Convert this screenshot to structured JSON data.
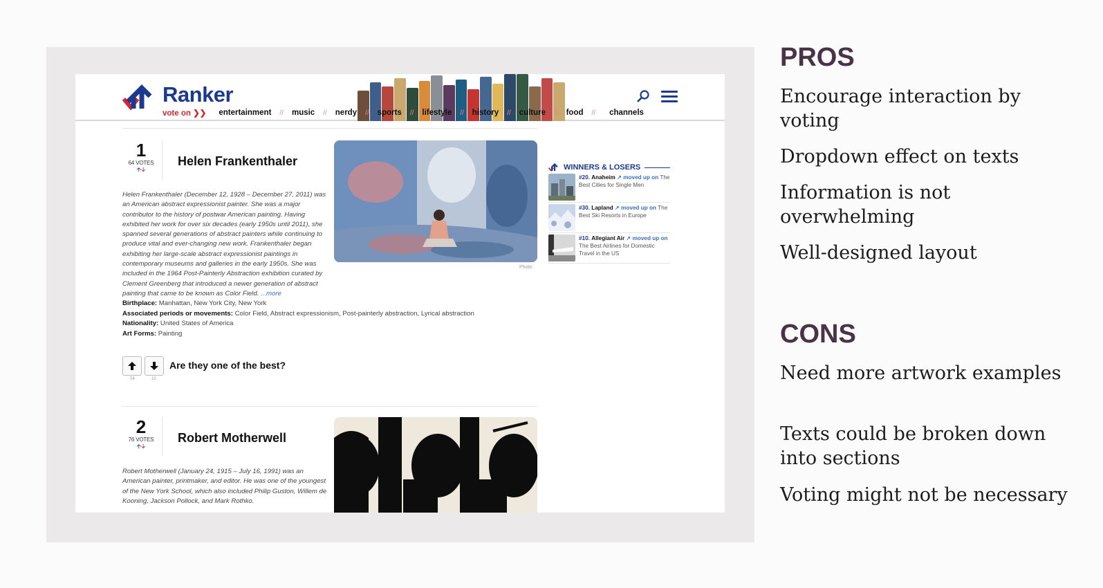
{
  "slide": {
    "pros_heading": "PROS",
    "pros": [
      "Encourage interaction by voting",
      "Dropdown effect on texts",
      "Information is not overwhelming",
      "Well-designed layout"
    ],
    "cons_heading": "CONS",
    "cons": [
      "Need more artwork examples",
      "Texts could be broken down into sections",
      "Voting might not be necessary"
    ]
  },
  "ranker": {
    "logo": "Ranker",
    "vote_on": "vote on",
    "nav": [
      "entertainment",
      "music",
      "nerdy",
      "sports",
      "lifestyle",
      "history",
      "culture",
      "food"
    ],
    "channels": "channels",
    "entries": [
      {
        "rank": "1",
        "votes": "64 VOTES",
        "name": "Helen Frankenthaler",
        "description": "Helen Frankenthaler (December 12, 1928 – December 27, 2011) was an American abstract expressionist painter. She was a major contributor to the history of postwar American painting. Having exhibited her work for over six decades (early 1950s until 2011), she spanned several generations of abstract painters while continuing to produce vital and ever-changing new work. Frankenthaler began exhibiting her large-scale abstract expressionist paintings in contemporary museums and galleries in the early 1950s. She was included in the 1964 Post-Painterly Abstraction exhibition curated by Clement Greenberg that introduced a newer generation of abstract painting that came to be known as Color Field.",
        "more": " ...more",
        "photo_caption": "Photo:",
        "facts": [
          {
            "label": "Birthplace:",
            "value": " Manhattan, New York City, New York"
          },
          {
            "label": "Associated periods or movements:",
            "value": " Color Field, Abstract expressionism, Post-painterly abstraction, Lyrical abstraction"
          },
          {
            "label": "Nationality:",
            "value": " United States of America"
          },
          {
            "label": "Art Forms:",
            "value": " Painting"
          }
        ],
        "up_count": "54",
        "down_count": "10",
        "question": "Are they one of the best?"
      },
      {
        "rank": "2",
        "votes": "76 VOTES",
        "name": "Robert Motherwell",
        "description": "Robert Motherwell (January 24, 1915 – July 16, 1991) was an American painter, printmaker, and editor. He was one of the youngest of the New York School, which also included Philip Guston, Willem de Kooning, Jackson Pollock, and Mark Rothko."
      }
    ],
    "winners": {
      "title": "WINNERS & LOSERS",
      "items": [
        {
          "rank": "#20.",
          "name": "Anaheim",
          "moved": "moved up on",
          "list": "The Best Cities for Single Men"
        },
        {
          "rank": "#30.",
          "name": "Lapland",
          "moved": "moved up on",
          "list": "The Best Ski Resorts in Europe"
        },
        {
          "rank": "#10.",
          "name": "Allegiant Air",
          "moved": "moved up on",
          "list": "The Best Airlines for Domestic Travel in the US"
        }
      ]
    }
  }
}
